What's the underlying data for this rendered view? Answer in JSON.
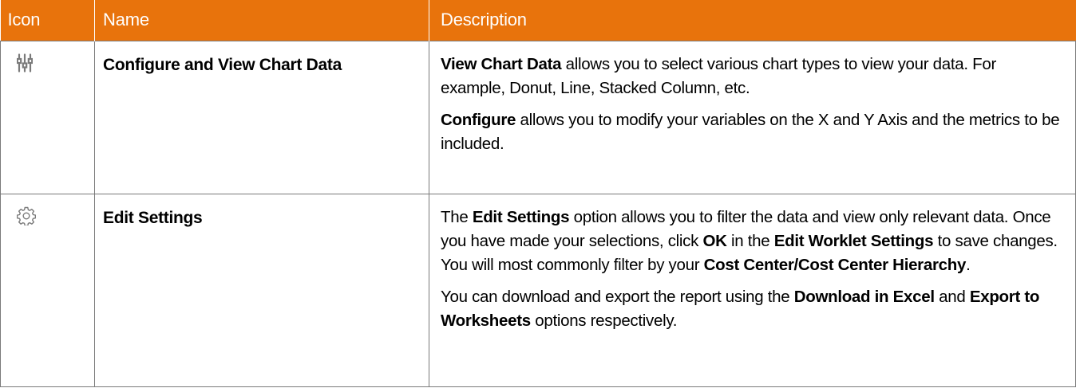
{
  "table": {
    "headers": {
      "icon": "Icon",
      "name": "Name",
      "description": "Description"
    },
    "rows": [
      {
        "icon": "chart-config-icon",
        "name": "Configure and View Chart Data",
        "desc": {
          "p1": {
            "b1": "View Chart Data",
            "t1": " allows you to select various chart types to view your data. For example, Donut, Line, Stacked Column, etc."
          },
          "p2": {
            "b1": "Configure",
            "t1": " allows you to modify your variables on the X and Y Axis and the metrics to be included."
          }
        }
      },
      {
        "icon": "gear-icon",
        "name": "Edit Settings",
        "desc": {
          "p1": {
            "t1": "The ",
            "b1": "Edit Settings",
            "t2": " option allows you to filter the data and view only relevant data. Once you have made your selections, click ",
            "b2": "OK",
            "t3": " in the ",
            "b3": "Edit Worklet Settings",
            "t4": " to save changes. You will most commonly filter by your ",
            "b4": "Cost Center/Cost Center Hierarchy",
            "t5": "."
          },
          "p2": {
            "t1": "You can download and export the report using the ",
            "b1": "Download in Excel",
            "t2": " and ",
            "b2": "Export to Worksheets",
            "t3": " options respectively."
          }
        }
      }
    ]
  },
  "colors": {
    "header_bg": "#e8730c",
    "header_text": "#ffffff",
    "icon_gray": "#7a7a7a",
    "border": "#7a7a7a"
  }
}
